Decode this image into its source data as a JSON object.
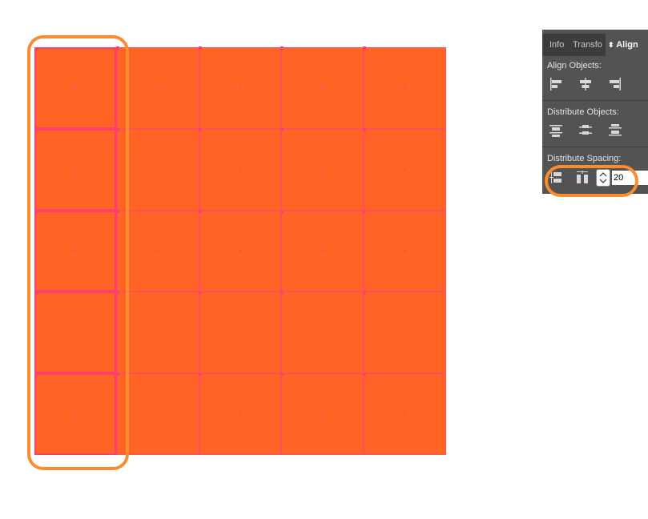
{
  "canvas": {
    "grid": {
      "rows": 5,
      "columns": 5,
      "fill_color": "#ff6325",
      "stroke_color": "#ff4f59"
    },
    "highlight_color": "#fb8c2d",
    "selected_column": 1
  },
  "panel": {
    "tabs": [
      {
        "label": "Info",
        "active": false
      },
      {
        "label": "Transfo",
        "active": false
      },
      {
        "label": "Align",
        "active": true
      }
    ],
    "align_objects_label": "Align Objects:",
    "distribute_objects_label": "Distribute Objects:",
    "distribute_spacing_label": "Distribute Spacing:",
    "spacing_value": "20",
    "align_icons": [
      "align-left-edges-icon",
      "align-horizontal-centers-icon",
      "align-right-edges-icon"
    ],
    "distribute_icons": [
      "distribute-top-edges-icon",
      "distribute-vertical-centers-icon",
      "distribute-bottom-edges-icon"
    ],
    "spacing_icons": [
      "distribute-vertical-space-icon",
      "distribute-horizontal-space-icon"
    ]
  }
}
